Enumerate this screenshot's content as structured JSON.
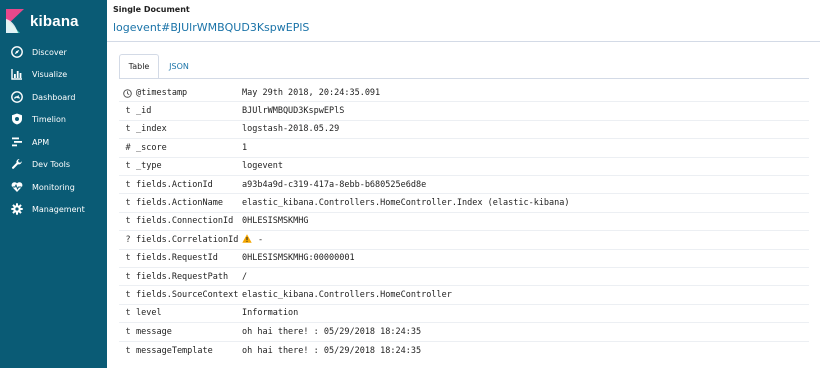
{
  "app": {
    "logo_text": "kibana"
  },
  "sidebar": {
    "items": [
      {
        "label": "Discover",
        "icon": "compass-icon"
      },
      {
        "label": "Visualize",
        "icon": "bar-chart-icon"
      },
      {
        "label": "Dashboard",
        "icon": "dashboard-icon"
      },
      {
        "label": "Timelion",
        "icon": "shield-icon"
      },
      {
        "label": "APM",
        "icon": "apm-icon"
      },
      {
        "label": "Dev Tools",
        "icon": "wrench-icon"
      },
      {
        "label": "Monitoring",
        "icon": "heartbeat-icon"
      },
      {
        "label": "Management",
        "icon": "gear-icon"
      }
    ]
  },
  "main": {
    "heading": "Single Document",
    "doc_title": "logevent#BJUlrWMBQUD3KspwEPlS",
    "tabs": [
      {
        "label": "Table",
        "active": true
      },
      {
        "label": "JSON",
        "active": false
      }
    ],
    "rows": [
      {
        "type": "clock",
        "field": "@timestamp",
        "value": "May 29th 2018, 20:24:35.091"
      },
      {
        "type": "t",
        "field": "_id",
        "value": "BJUlrWMBQUD3KspwEPlS"
      },
      {
        "type": "t",
        "field": "_index",
        "value": "logstash-2018.05.29"
      },
      {
        "type": "#",
        "field": "_score",
        "value": "1"
      },
      {
        "type": "t",
        "field": "_type",
        "value": "logevent"
      },
      {
        "type": "t",
        "field": "fields.ActionId",
        "value": "a93b4a9d-c319-417a-8ebb-b680525e6d8e"
      },
      {
        "type": "t",
        "field": "fields.ActionName",
        "value": "elastic_kibana.Controllers.HomeController.Index (elastic-kibana)"
      },
      {
        "type": "t",
        "field": "fields.ConnectionId",
        "value": "0HLESISMSKMHG"
      },
      {
        "type": "?",
        "field": "fields.CorrelationId",
        "value": "-",
        "warning": true
      },
      {
        "type": "t",
        "field": "fields.RequestId",
        "value": "0HLESISMSKMHG:00000001"
      },
      {
        "type": "t",
        "field": "fields.RequestPath",
        "value": "/"
      },
      {
        "type": "t",
        "field": "fields.SourceContext",
        "value": "elastic_kibana.Controllers.HomeController"
      },
      {
        "type": "t",
        "field": "level",
        "value": "Information"
      },
      {
        "type": "t",
        "field": "message",
        "value": "oh hai there! : 05/29/2018 18:24:35"
      },
      {
        "type": "t",
        "field": "messageTemplate",
        "value": "oh hai there! : 05/29/2018 18:24:35"
      }
    ]
  },
  "colors": {
    "sidebar_bg": "#0a5b75",
    "link_blue": "#1a73a8",
    "warning": "#f5a700"
  }
}
